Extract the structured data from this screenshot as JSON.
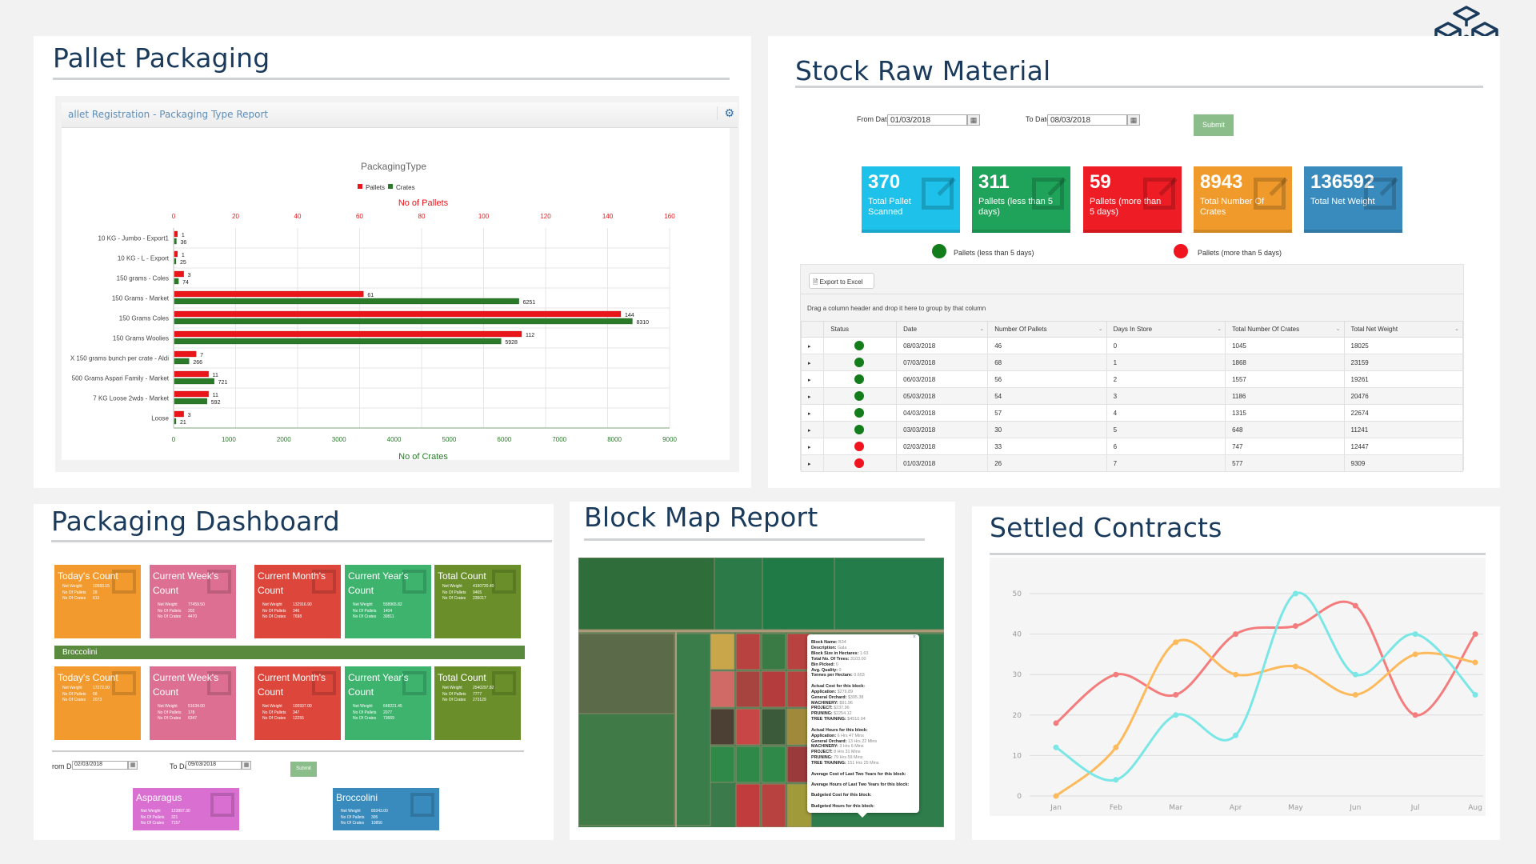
{
  "logo": {
    "icon": "cubes-icon",
    "color": "#1a3a5c"
  },
  "pallet_packaging": {
    "title": "Pallet Packaging",
    "report_header": "allet Registration - Packaging Type Report",
    "settings_icon": "gear-icon",
    "chart_data": {
      "type": "bar",
      "orientation": "horizontal",
      "title": "PackagingType",
      "legend": [
        "Pallets",
        "Crates"
      ],
      "legend_position": "top",
      "top_axis_label": "No of Pallets",
      "bottom_axis_label": "No of Crates",
      "top_ticks": [
        "0",
        "20",
        "40",
        "60",
        "80",
        "100",
        "120",
        "140",
        "160"
      ],
      "bottom_ticks": [
        "0",
        "1000",
        "2000",
        "3000",
        "4000",
        "5000",
        "6000",
        "7000",
        "8000",
        "9000"
      ],
      "pallets_range": [
        0,
        160
      ],
      "crates_range": [
        0,
        9000
      ],
      "categories": [
        "10 KG - Jumbo - Export1",
        "10 KG - L - Export",
        "150 grams - Coles",
        "150 Grams - Market",
        "150 Grams Coles",
        "150 Grams Woolies",
        "X 150 grams bunch per crate - Aldi",
        "500 Grams Aspari Family - Market",
        "7 KG Loose 2wds - Market",
        "Loose"
      ],
      "series": [
        {
          "name": "Pallets",
          "color": "#e8161b",
          "values": [
            1,
            1,
            3,
            61,
            144,
            112,
            7,
            11,
            11,
            3
          ]
        },
        {
          "name": "Crates",
          "color": "#2a7a2a",
          "values": [
            36,
            25,
            74,
            6251,
            8310,
            5928,
            266,
            721,
            592,
            21
          ]
        }
      ]
    }
  },
  "stock_raw_material": {
    "title": "Stock Raw Material",
    "from_label": "From Date",
    "from_value": "01/03/2018",
    "to_label": "To Date",
    "to_value": "08/03/2018",
    "submit": "Submit",
    "kpis": [
      {
        "value": "370",
        "label": "Total Pallet Scanned",
        "color": "#1ec1ea"
      },
      {
        "value": "311",
        "label": "Pallets (less than 5 days)",
        "color": "#1fa35a"
      },
      {
        "value": "59",
        "label": "Pallets (more than 5 days)",
        "color": "#ee1c24"
      },
      {
        "value": "8943",
        "label": "Total Number Of Crates",
        "color": "#f09a2b"
      },
      {
        "value": "136592",
        "label": "Total Net Weight",
        "color": "#3a8bbd"
      }
    ],
    "legend": [
      {
        "label": "Pallets (less than 5 days)",
        "color": "#137d1b"
      },
      {
        "label": "Pallets (more than 5 days)",
        "color": "#f0141e"
      }
    ],
    "export_label": "Export to Excel",
    "group_hint": "Drag a column header and drop it here to group by that column",
    "columns": [
      "Status",
      "Date",
      "Number Of Pallets",
      "Days In Store",
      "Total Number Of Crates",
      "Total Net Weight"
    ],
    "rows": [
      {
        "status": "green",
        "date": "08/03/2018",
        "pallets": "46",
        "days": "0",
        "crates": "1045",
        "weight": "18025"
      },
      {
        "status": "green",
        "date": "07/03/2018",
        "pallets": "68",
        "days": "1",
        "crates": "1868",
        "weight": "23159"
      },
      {
        "status": "green",
        "date": "06/03/2018",
        "pallets": "56",
        "days": "2",
        "crates": "1557",
        "weight": "19261"
      },
      {
        "status": "green",
        "date": "05/03/2018",
        "pallets": "54",
        "days": "3",
        "crates": "1186",
        "weight": "20476"
      },
      {
        "status": "green",
        "date": "04/03/2018",
        "pallets": "57",
        "days": "4",
        "crates": "1315",
        "weight": "22674"
      },
      {
        "status": "green",
        "date": "03/03/2018",
        "pallets": "30",
        "days": "5",
        "crates": "648",
        "weight": "11241"
      },
      {
        "status": "red",
        "date": "02/03/2018",
        "pallets": "33",
        "days": "6",
        "crates": "747",
        "weight": "12447"
      },
      {
        "status": "red",
        "date": "01/03/2018",
        "pallets": "26",
        "days": "7",
        "crates": "577",
        "weight": "9309"
      }
    ]
  },
  "packaging_dashboard": {
    "title": "Packaging Dashboard",
    "row_labels": {
      "net_weight": "Net Weight",
      "pallets": "No Of Pallets",
      "crates": "No Of Crates"
    },
    "group1": [
      {
        "title": "Today's Count",
        "color": "#f29a2e",
        "net_weight": "10583.15",
        "pallets": "28",
        "crates": "613"
      },
      {
        "title": "Current Week's Count",
        "color": "#dc6f92",
        "net_weight": "77459.50",
        "pallets": "202",
        "crates": "4470"
      },
      {
        "title": "Current Month's Count",
        "color": "#dc463b",
        "net_weight": "132916.90",
        "pallets": "346",
        "crates": "7698"
      },
      {
        "title": "Current Year's Count",
        "color": "#3db36e",
        "net_weight": "558965.82",
        "pallets": "1404",
        "crates": "30811"
      },
      {
        "title": "Total Count",
        "color": "#6a8f2a",
        "net_weight": "4190720.40",
        "pallets": "9465",
        "crates": "236017"
      }
    ],
    "band_label": "Broccolini",
    "group2": [
      {
        "title": "Today's Count",
        "color": "#f29a2e",
        "net_weight": "17272.00",
        "pallets": "58",
        "crates": "2073"
      },
      {
        "title": "Current Week's Count",
        "color": "#dc6f92",
        "net_weight": "51634.00",
        "pallets": "178",
        "crates": "6347"
      },
      {
        "title": "Current Month's Count",
        "color": "#dc463b",
        "net_weight": "100937.00",
        "pallets": "347",
        "crates": "12255"
      },
      {
        "title": "Current Year's Count",
        "color": "#3db36e",
        "net_weight": "648221.45",
        "pallets": "2077",
        "crates": "73669"
      },
      {
        "title": "Total Count",
        "color": "#6a8f2a",
        "net_weight": "2540297.82",
        "pallets": "7777",
        "crates": "273129"
      }
    ],
    "from_label": "rom Date",
    "from_value": "02/03/2018",
    "to_label": "To Date",
    "to_value": "09/03/2018",
    "submit": "Submit",
    "products": [
      {
        "title": "Asparagus",
        "color": "#d96fd0",
        "net_weight": "123897.30",
        "pallets": "321",
        "crates": "7157"
      },
      {
        "title": "Broccolini",
        "color": "#3a8bbd",
        "net_weight": "89343.00",
        "pallets": "305",
        "crates": "10856"
      }
    ]
  },
  "block_map": {
    "title": "Block Map Report",
    "popup": {
      "close": "×",
      "fields": [
        {
          "k": "Block Name:",
          "v": "B34"
        },
        {
          "k": "Description:",
          "v": "Gala"
        },
        {
          "k": "Block Size in Hectares:",
          "v": "1.63"
        },
        {
          "k": "Total No. Of Trees:",
          "v": "3103.00"
        },
        {
          "k": "Bin Picked:",
          "v": "0"
        },
        {
          "k": "Avg. Quality:",
          "v": "0"
        },
        {
          "k": "Tonnes per Hectare:",
          "v": "0.603"
        }
      ],
      "cost_heading": "Actual Cost for this block:",
      "costs": [
        {
          "k": "Application:",
          "v": "$276.89"
        },
        {
          "k": "General Orchard:",
          "v": "$395.38"
        },
        {
          "k": "MACHINERY:",
          "v": "$91.96"
        },
        {
          "k": "PROJECT:",
          "v": "$237.96"
        },
        {
          "k": "PRUNING:",
          "v": "$2254.12"
        },
        {
          "k": "TREE TRAINING:",
          "v": "$4510.04"
        }
      ],
      "hours_heading": "Actual Hours for this block:",
      "hours": [
        {
          "k": "Application:",
          "v": "6 Hrs 47 Mins"
        },
        {
          "k": "General Orchard:",
          "v": "13 Hrs 22 Mins"
        },
        {
          "k": "MACHINERY:",
          "v": "3 Hrs 6 Mins"
        },
        {
          "k": "PROJECT:",
          "v": "8 Hrs 31 Mins"
        },
        {
          "k": "PRUNING:",
          "v": "79 Hrs 59 Mins"
        },
        {
          "k": "TREE TRAINING:",
          "v": "151 Hrs 25 Mins"
        }
      ],
      "avg_cost": "Average Cost of Last Two Years for this block:",
      "avg_hours": "Average Hours of Last Two Years for this block:",
      "budget_cost": "Budgeted Cost for this block:",
      "budget_hours": "Budgeted Hours for this block:"
    }
  },
  "settled_contracts": {
    "title": "Settled Contracts",
    "chart_data": {
      "type": "line",
      "title": "",
      "categories": [
        "Jan",
        "Feb",
        "Mar",
        "Apr",
        "May",
        "Jun",
        "Jul",
        "Aug"
      ],
      "ylim": [
        0,
        50
      ],
      "yticks": [
        "0",
        "10",
        "20",
        "30",
        "40",
        "50"
      ],
      "grid": true,
      "smooth": true,
      "series": [
        {
          "name": "red",
          "color": "#f47c7c",
          "values": [
            18,
            30,
            25,
            40,
            42,
            47,
            20,
            40
          ]
        },
        {
          "name": "orange",
          "color": "#fdba5c",
          "values": [
            0,
            12,
            38,
            30,
            32,
            25,
            35,
            33
          ]
        },
        {
          "name": "cyan",
          "color": "#7ae6e6",
          "values": [
            12,
            4,
            20,
            15,
            50,
            30,
            40,
            25
          ]
        }
      ]
    }
  }
}
